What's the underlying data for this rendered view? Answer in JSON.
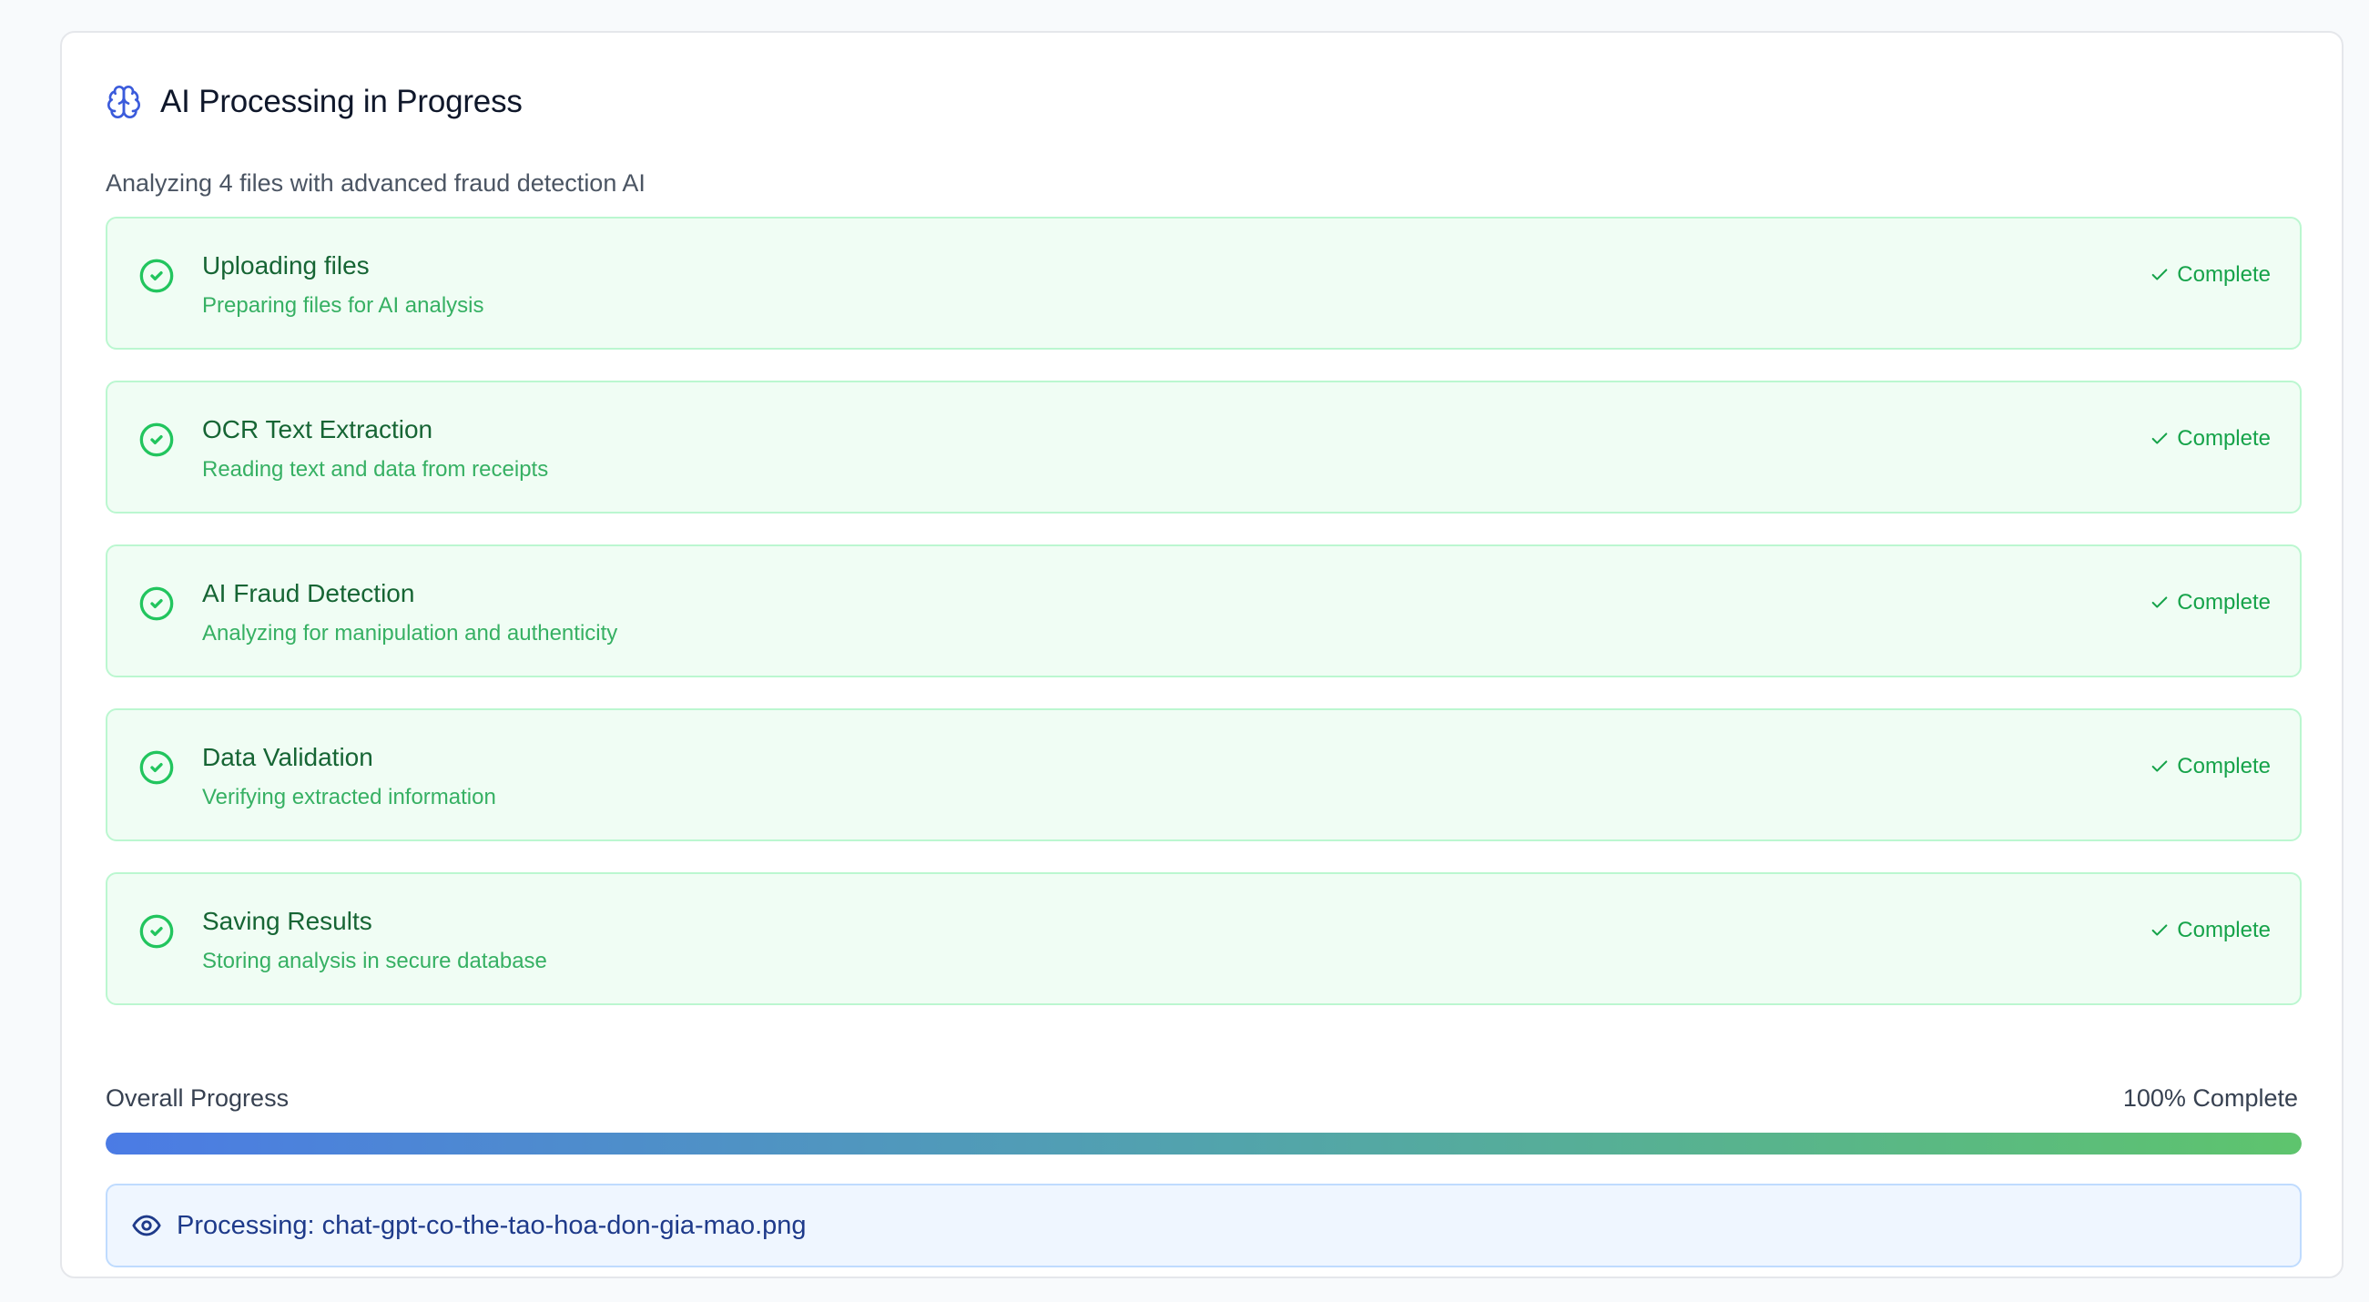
{
  "header": {
    "icon": "brain-icon",
    "title": "AI Processing in Progress",
    "subtitle": "Analyzing 4 files with advanced fraud detection AI"
  },
  "steps": [
    {
      "title": "Uploading files",
      "description": "Preparing files for AI analysis",
      "status": "Complete",
      "icon": "circle-check-icon"
    },
    {
      "title": "OCR Text Extraction",
      "description": "Reading text and data from receipts",
      "status": "Complete",
      "icon": "circle-check-icon"
    },
    {
      "title": "AI Fraud Detection",
      "description": "Analyzing for manipulation and authenticity",
      "status": "Complete",
      "icon": "circle-check-icon"
    },
    {
      "title": "Data Validation",
      "description": "Verifying extracted information",
      "status": "Complete",
      "icon": "circle-check-icon"
    },
    {
      "title": "Saving Results",
      "description": "Storing analysis in secure database",
      "status": "Complete",
      "icon": "circle-check-icon"
    }
  ],
  "progress": {
    "label": "Overall Progress",
    "value_text": "100% Complete",
    "percent": 100
  },
  "processing": {
    "icon": "eye-icon",
    "text": "Processing: chat-gpt-co-the-tao-hoa-don-gia-mao.png"
  },
  "colors": {
    "accent_blue": "#3b5bdb",
    "success_green": "#16a34a",
    "step_bg": "#f0fdf4",
    "step_border": "#bbf7d0",
    "info_bg": "#eff6ff",
    "info_border": "#bfdbfe"
  }
}
